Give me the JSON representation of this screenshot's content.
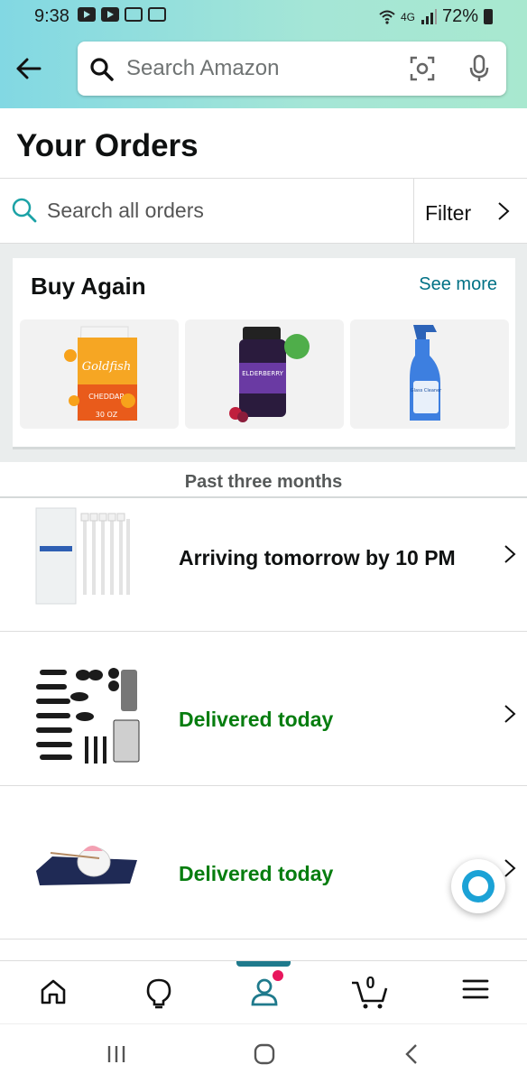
{
  "status_bar": {
    "time": "9:38",
    "network": "4G",
    "battery": "72%"
  },
  "header": {
    "search_placeholder": "Search Amazon"
  },
  "page": {
    "title": "Your Orders"
  },
  "order_search": {
    "placeholder": "Search all orders",
    "filter_label": "Filter"
  },
  "buy_again": {
    "heading": "Buy Again",
    "see_more": "See more",
    "items": [
      {
        "name": "Goldfish Cheddar crackers carton"
      },
      {
        "name": "Elderberry gummies bottle"
      },
      {
        "name": "Glass cleaner spray bottle"
      }
    ]
  },
  "orders": {
    "section_label": "Past three months",
    "items": [
      {
        "status": "Arriving tomorrow by 10 PM",
        "status_color": "#0f1111",
        "thumb": "cable-ties-icon"
      },
      {
        "status": "Delivered today",
        "status_color": "#067d0f",
        "thumb": "kitchen-utensils-icon"
      },
      {
        "status": "Delivered today",
        "status_color": "#067d0f",
        "thumb": "incense-holder-icon"
      }
    ]
  },
  "bottom_nav": {
    "cart_count": "0",
    "active": "account",
    "accent_color": "#1f7a8c"
  }
}
